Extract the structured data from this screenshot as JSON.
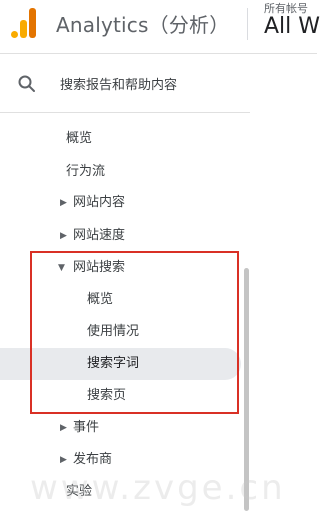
{
  "header": {
    "app_title": "Analytics（分析）",
    "account_label": "所有帐号",
    "account_value": "All We"
  },
  "search": {
    "label": "搜索报告和帮助内容"
  },
  "nav": {
    "overview": "概览",
    "behavior_flow": "行为流",
    "site_content": "网站内容",
    "site_speed": "网站速度",
    "site_search": "网站搜索",
    "site_search_overview": "概览",
    "usage": "使用情况",
    "search_terms": "搜索字词",
    "search_pages": "搜索页",
    "events": "事件",
    "publisher": "发布商",
    "experiments": "实验"
  },
  "watermark": "www.zvge.cn",
  "colors": {
    "logo_light": "#f9ab00",
    "logo_dark": "#e37400",
    "highlight_box": "#d93025",
    "selected_bg": "#e8eaed"
  }
}
